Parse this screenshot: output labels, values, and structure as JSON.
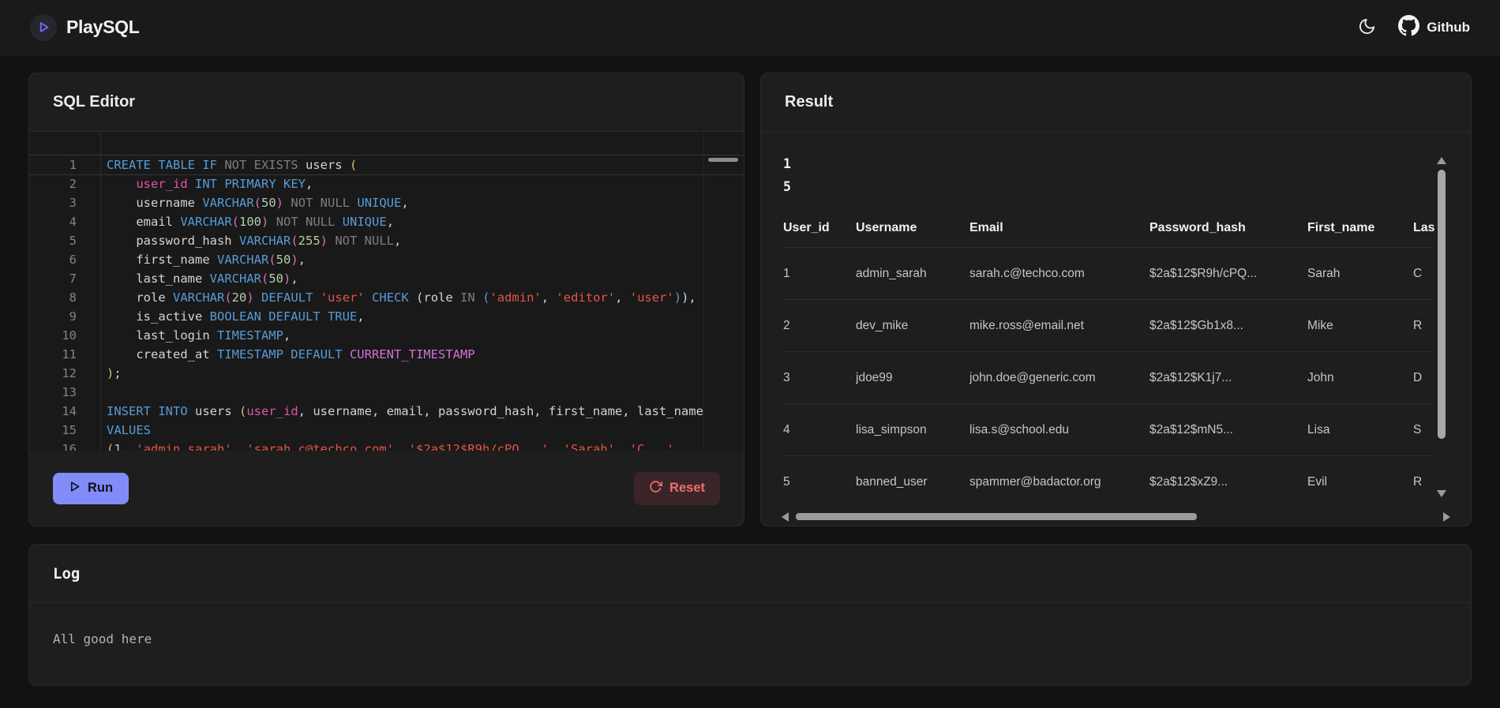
{
  "navbar": {
    "title": "PlaySQL",
    "github_label": "Github",
    "icons": {
      "logo": "play-icon",
      "theme": "moon-icon",
      "github": "github-icon"
    }
  },
  "colors": {
    "accent": "#818cf8",
    "run_bg": "#818cf8",
    "reset_bg": "#392527",
    "reset_text": "#f26d6d",
    "panel_bg": "#1e1e1e",
    "editor_bg": "#191919",
    "page_bg": "#121212",
    "syntax": {
      "keyword": "#569cd6",
      "operator_gray": "#7d7d7d",
      "identifier_pink": "#e056a8",
      "builtin_magenta": "#d56fd5",
      "number": "#b5cea8",
      "string": "#e5534b",
      "bracket_gold": "#d7ba7d",
      "bracket_pink": "#d671b0",
      "plain": "#d4d4d4"
    }
  },
  "editor_panel": {
    "title": "SQL Editor",
    "run_label": "Run",
    "reset_label": "Reset"
  },
  "editor": {
    "lines": [
      {
        "n": "1",
        "active": true,
        "tokens": [
          [
            "CREATE TABLE IF ",
            "kw"
          ],
          [
            "NOT EXISTS",
            "gy"
          ],
          [
            " users ",
            "pl"
          ],
          [
            "(",
            "p1"
          ]
        ]
      },
      {
        "n": "2",
        "tokens": [
          [
            "    ",
            "pl"
          ],
          [
            "user_id",
            "pk"
          ],
          [
            " ",
            "pl"
          ],
          [
            "INT PRIMARY KEY",
            "kw"
          ],
          [
            ",",
            "pl"
          ]
        ]
      },
      {
        "n": "3",
        "tokens": [
          [
            "    username ",
            "pl"
          ],
          [
            "VARCHAR",
            "kw"
          ],
          [
            "(",
            "p2"
          ],
          [
            "50",
            "nm"
          ],
          [
            ")",
            "p2"
          ],
          [
            " ",
            "pl"
          ],
          [
            "NOT NULL",
            "gy"
          ],
          [
            " ",
            "pl"
          ],
          [
            "UNIQUE",
            "kw"
          ],
          [
            ",",
            "pl"
          ]
        ]
      },
      {
        "n": "4",
        "tokens": [
          [
            "    email ",
            "pl"
          ],
          [
            "VARCHAR",
            "kw"
          ],
          [
            "(",
            "p2"
          ],
          [
            "100",
            "nm"
          ],
          [
            ")",
            "p2"
          ],
          [
            " ",
            "pl"
          ],
          [
            "NOT NULL",
            "gy"
          ],
          [
            " ",
            "pl"
          ],
          [
            "UNIQUE",
            "kw"
          ],
          [
            ",",
            "pl"
          ]
        ]
      },
      {
        "n": "5",
        "tokens": [
          [
            "    password_hash ",
            "pl"
          ],
          [
            "VARCHAR",
            "kw"
          ],
          [
            "(",
            "p2"
          ],
          [
            "255",
            "nm"
          ],
          [
            ")",
            "p2"
          ],
          [
            " ",
            "pl"
          ],
          [
            "NOT NULL",
            "gy"
          ],
          [
            ",",
            "pl"
          ]
        ]
      },
      {
        "n": "6",
        "tokens": [
          [
            "    first_name ",
            "pl"
          ],
          [
            "VARCHAR",
            "kw"
          ],
          [
            "(",
            "p2"
          ],
          [
            "50",
            "nm"
          ],
          [
            ")",
            "p2"
          ],
          [
            ",",
            "pl"
          ]
        ]
      },
      {
        "n": "7",
        "tokens": [
          [
            "    last_name ",
            "pl"
          ],
          [
            "VARCHAR",
            "kw"
          ],
          [
            "(",
            "p2"
          ],
          [
            "50",
            "nm"
          ],
          [
            ")",
            "p2"
          ],
          [
            ",",
            "pl"
          ]
        ]
      },
      {
        "n": "8",
        "tokens": [
          [
            "    role ",
            "pl"
          ],
          [
            "VARCHAR",
            "kw"
          ],
          [
            "(",
            "p2"
          ],
          [
            "20",
            "nm"
          ],
          [
            ")",
            "p2"
          ],
          [
            " ",
            "pl"
          ],
          [
            "DEFAULT",
            "kw"
          ],
          [
            " ",
            "pl"
          ],
          [
            "'user'",
            "st"
          ],
          [
            " ",
            "pl"
          ],
          [
            "CHECK",
            "kw"
          ],
          [
            " (role ",
            "pl"
          ],
          [
            "IN",
            "gy"
          ],
          [
            " ",
            "pl"
          ],
          [
            "(",
            "p3"
          ],
          [
            "'admin'",
            "st"
          ],
          [
            ", ",
            "pl"
          ],
          [
            "'editor'",
            "st"
          ],
          [
            ", ",
            "pl"
          ],
          [
            "'user'",
            "st"
          ],
          [
            ")",
            "p3"
          ],
          [
            "),",
            "pl"
          ]
        ]
      },
      {
        "n": "9",
        "tokens": [
          [
            "    is_active ",
            "pl"
          ],
          [
            "BOOLEAN DEFAULT TRUE",
            "kw"
          ],
          [
            ",",
            "pl"
          ]
        ]
      },
      {
        "n": "10",
        "tokens": [
          [
            "    last_login ",
            "pl"
          ],
          [
            "TIMESTAMP",
            "kw"
          ],
          [
            ",",
            "pl"
          ]
        ]
      },
      {
        "n": "11",
        "tokens": [
          [
            "    created_at ",
            "pl"
          ],
          [
            "TIMESTAMP DEFAULT ",
            "kw"
          ],
          [
            "CURRENT_TIMESTAMP",
            "mg"
          ]
        ]
      },
      {
        "n": "12",
        "tokens": [
          [
            ")",
            "p1"
          ],
          [
            ";",
            "pl"
          ]
        ]
      },
      {
        "n": "13",
        "tokens": []
      },
      {
        "n": "14",
        "tokens": [
          [
            "INSERT INTO",
            "kw"
          ],
          [
            " users ",
            "pl"
          ],
          [
            "(",
            "p1"
          ],
          [
            "user_id",
            "pk"
          ],
          [
            ", username, email, password_hash, first_name, last_name",
            "pl"
          ]
        ]
      },
      {
        "n": "15",
        "tokens": [
          [
            "VALUES",
            "kw"
          ]
        ]
      },
      {
        "n": "16",
        "tokens": [
          [
            "(",
            "p1"
          ],
          [
            "1",
            "nm"
          ],
          [
            ", ",
            "pl"
          ],
          [
            "'admin_sarah'",
            "st"
          ],
          [
            ", ",
            "pl"
          ],
          [
            "'sarah.c@techco.com'",
            "st"
          ],
          [
            ", ",
            "pl"
          ],
          [
            "'$2a$12$R9h/cPQ...'",
            "st"
          ],
          [
            ", ",
            "pl"
          ],
          [
            "'Sarah'",
            "st"
          ],
          [
            ", ",
            "pl"
          ],
          [
            "'C...'",
            "st"
          ]
        ]
      }
    ]
  },
  "result_panel": {
    "title": "Result",
    "meta_lines": [
      "1",
      "5"
    ],
    "table": {
      "headers": [
        "User_id",
        "Username",
        "Email",
        "Password_hash",
        "First_name",
        "Last_name"
      ],
      "rows": [
        [
          "1",
          "admin_sarah",
          "sarah.c@techco.com",
          "$2a$12$R9h/cPQ...",
          "Sarah",
          "C"
        ],
        [
          "2",
          "dev_mike",
          "mike.ross@email.net",
          "$2a$12$Gb1x8...",
          "Mike",
          "R"
        ],
        [
          "3",
          "jdoe99",
          "john.doe@generic.com",
          "$2a$12$K1j7...",
          "John",
          "D"
        ],
        [
          "4",
          "lisa_simpson",
          "lisa.s@school.edu",
          "$2a$12$mN5...",
          "Lisa",
          "S"
        ],
        [
          "5",
          "banned_user",
          "spammer@badactor.org",
          "$2a$12$xZ9...",
          "Evil",
          "R"
        ]
      ]
    }
  },
  "log_panel": {
    "title": "Log",
    "message": "All good here"
  }
}
